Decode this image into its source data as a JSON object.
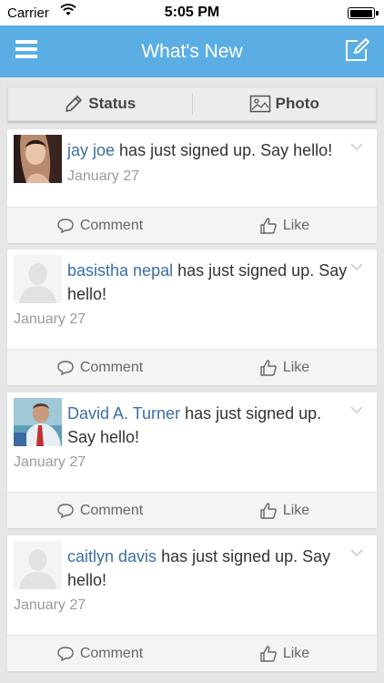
{
  "status_bar": {
    "carrier": "Carrier",
    "time": "5:05 PM"
  },
  "navbar": {
    "title": "What's New"
  },
  "post_bar": {
    "status_label": "Status",
    "photo_label": "Photo"
  },
  "feed": [
    {
      "name": "jay joe",
      "text": "has just signed up. Say hello!",
      "date": "January 27",
      "avatar": "photo-woman"
    },
    {
      "name": "basistha nepal",
      "text": "has just signed up. Say hello!",
      "date": "January 27",
      "avatar": "default-avatar"
    },
    {
      "name": "David A. Turner",
      "text": "has just signed up. Say hello!",
      "date": "January 27",
      "avatar": "photo-man"
    },
    {
      "name": "caitlyn davis",
      "text": "has just signed up. Say hello!",
      "date": "January 27",
      "avatar": "default-avatar"
    }
  ],
  "actions": {
    "comment_label": "Comment",
    "like_label": "Like"
  },
  "colors": {
    "navbar": "#5aaee3",
    "link": "#3b6fa6",
    "background": "#e6e6e6"
  }
}
